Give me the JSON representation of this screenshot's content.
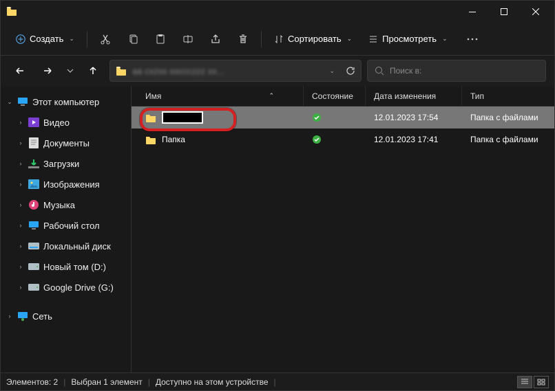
{
  "titlebar": {
    "title": ""
  },
  "toolbar": {
    "create": "Создать",
    "sort": "Сортировать",
    "view": "Просмотреть"
  },
  "nav": {
    "path_blur": "aa cxzss ssccczzz xx...",
    "search_placeholder": "Поиск в:"
  },
  "sidebar": {
    "this_pc": "Этот компьютер",
    "items": [
      "Видео",
      "Документы",
      "Загрузки",
      "Изображения",
      "Музыка",
      "Рабочий стол",
      "Локальный диск",
      "Новый том (D:)",
      "Google Drive (G:)"
    ],
    "network": "Сеть"
  },
  "columns": {
    "name": "Имя",
    "state": "Состояние",
    "date": "Дата изменения",
    "type": "Тип"
  },
  "rows": [
    {
      "name": "",
      "renaming": true,
      "date": "12.01.2023 17:54",
      "type": "Папка с файлами"
    },
    {
      "name": "Папка",
      "renaming": false,
      "date": "12.01.2023 17:41",
      "type": "Папка с файлами"
    }
  ],
  "status": {
    "count": "Элементов: 2",
    "selected": "Выбран 1 элемент",
    "available": "Доступно на этом устройстве"
  }
}
